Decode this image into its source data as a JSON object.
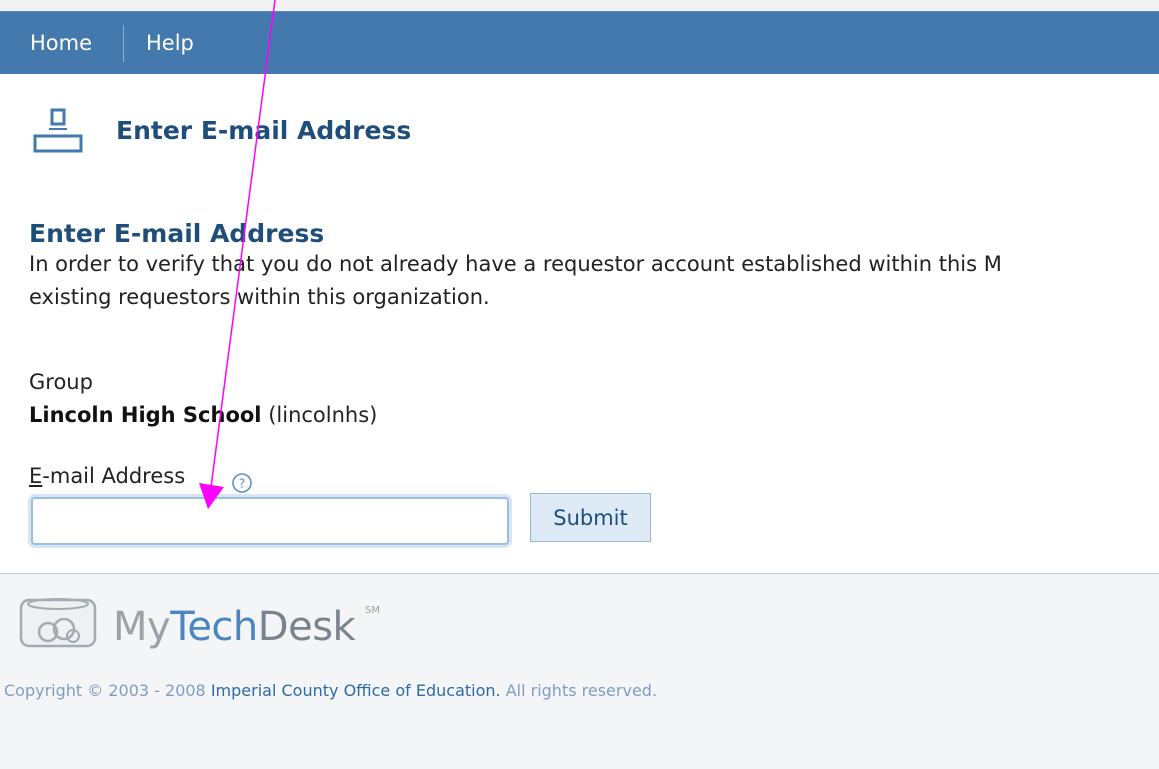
{
  "nav": {
    "home_label": "Home",
    "help_label": "Help"
  },
  "header": {
    "icon": "computer-terminal-icon",
    "title": "Enter E-mail Address"
  },
  "section": {
    "heading": "Enter E-mail Address",
    "intro_line1": "In order to verify that you do not already have a requestor account established within this M",
    "intro_line2": "existing requestors within this organization."
  },
  "group": {
    "label": "Group",
    "name": "Lincoln High School",
    "code": "(lincolnhs)"
  },
  "email": {
    "label_first_letter": "E",
    "label_rest": "-mail Address",
    "help_icon": "question-mark-icon",
    "value": "",
    "submit_label": "Submit"
  },
  "footer": {
    "brand_my": "My",
    "brand_tech": "Tech",
    "brand_desk": "Desk",
    "brand_mark": "SM",
    "copyright_prefix": "Copyright © 2003 - 2008",
    "copyright_org": "Imperial County Office of Education.",
    "copyright_suffix": "All rights reserved."
  },
  "colors": {
    "nav_bar": "#4379ad",
    "heading": "#1f4e7a",
    "annotation_arrow": "#ff00ff"
  }
}
